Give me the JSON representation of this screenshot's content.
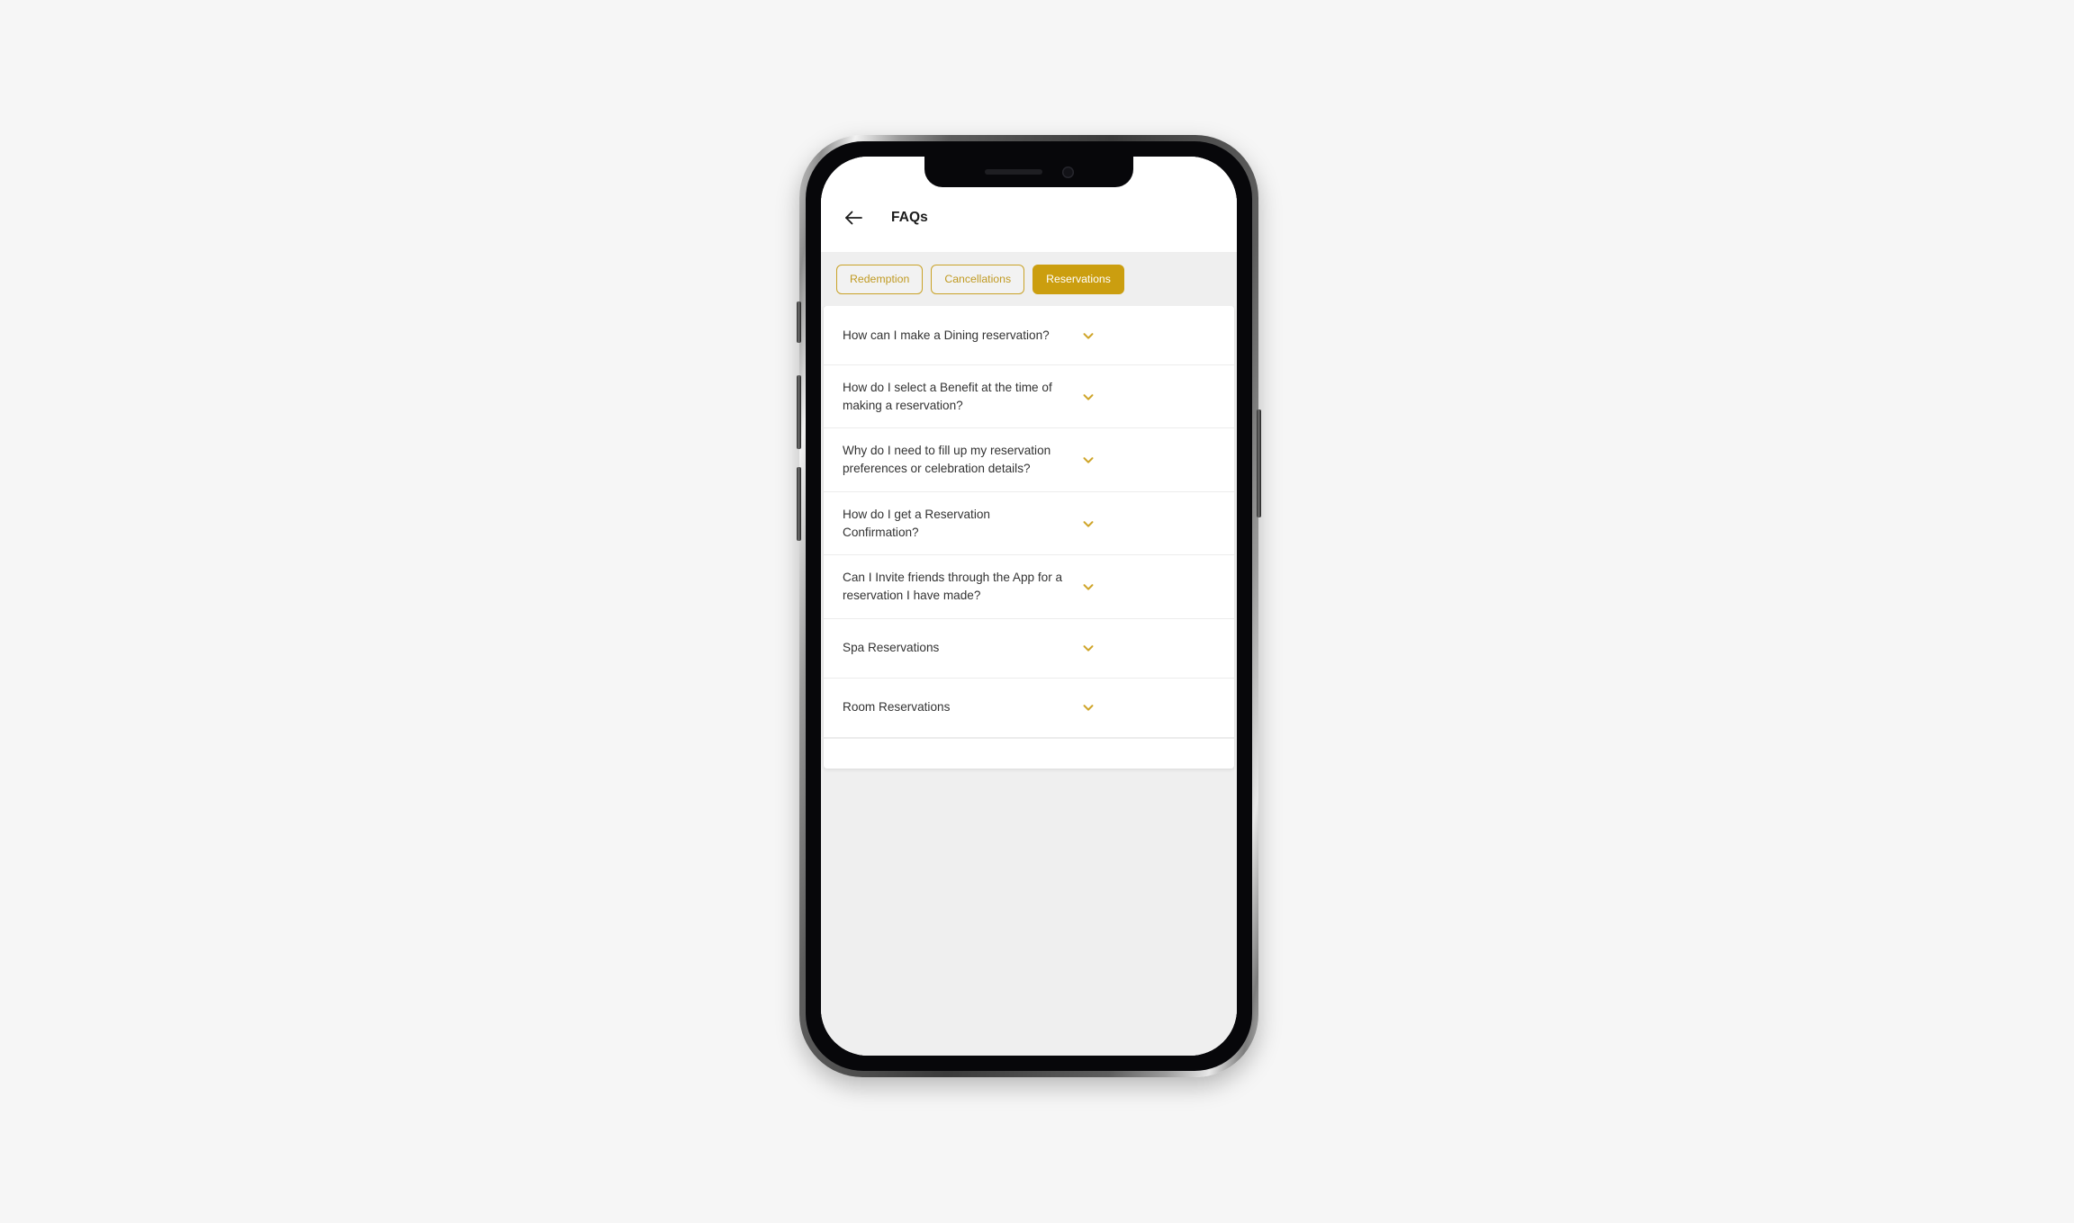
{
  "app": {
    "title": "FAQs",
    "back_icon": "arrow-left-icon"
  },
  "theme": {
    "accent": "#cb9e0f",
    "chip_border": "#c9a227",
    "chip_text": "#c09a22",
    "chip_active_text": "#ffffff",
    "chevron": "#cfa52a",
    "page_bg": "#f6f6f6",
    "app_bg": "#efefef",
    "card_bg": "#ffffff",
    "text": "#333333"
  },
  "filters": [
    {
      "label": "Redemption",
      "active": false
    },
    {
      "label": "Cancellations",
      "active": false
    },
    {
      "label": "Reservations",
      "active": true
    }
  ],
  "faqs": [
    {
      "question": "How can I make a Dining reservation?",
      "expanded": false,
      "chevron": "chevron-down-icon"
    },
    {
      "question": "How do I select a Benefit at the time of making a reservation?",
      "expanded": false,
      "chevron": "chevron-down-icon"
    },
    {
      "question": "Why do I need to fill up my reservation preferences or celebration details?",
      "expanded": false,
      "chevron": "chevron-down-icon"
    },
    {
      "question": "How do I get a Reservation Confirmation?",
      "expanded": false,
      "chevron": "chevron-down-icon"
    },
    {
      "question": "Can I Invite friends through the App for a reservation I have made?",
      "expanded": false,
      "chevron": "chevron-down-icon"
    },
    {
      "question": "Spa Reservations",
      "expanded": false,
      "chevron": "chevron-down-icon"
    },
    {
      "question": "Room Reservations",
      "expanded": false,
      "chevron": "chevron-down-icon"
    }
  ],
  "device": {
    "notch_speaker": "speaker-slot",
    "notch_camera": "front-camera-icon",
    "buttons": [
      "mute-switch",
      "volume-up-button",
      "volume-down-button",
      "power-button"
    ]
  }
}
